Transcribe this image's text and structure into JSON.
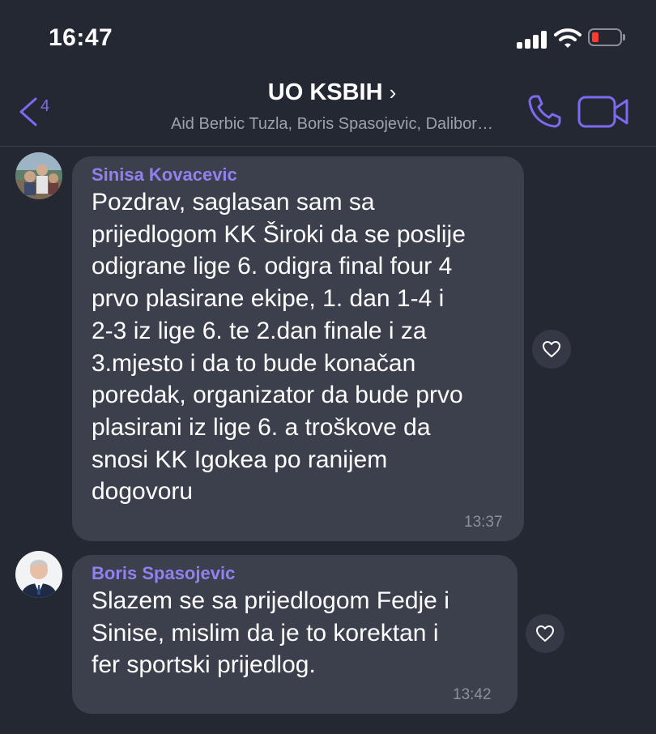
{
  "status_bar": {
    "time": "16:47",
    "signal_icon": "cellular-signal-icon",
    "wifi_icon": "wifi-icon",
    "battery_icon": "battery-low-icon",
    "battery_color": "#ff3b30"
  },
  "header": {
    "back_count": "4",
    "title": "UO KSBIH",
    "title_chevron": "›",
    "subtitle": "Aid Berbic Tuzla, Boris Spasojevic, Dalibor…",
    "accent_color": "#7c6bf0"
  },
  "messages": [
    {
      "sender": "Sinisa Kovacevic",
      "text": "Pozdrav, saglasan sam sa\nprijedlogom KK Široki da se poslije\nodigrane lige 6. odigra final four 4\nprvo plasirane ekipe, 1. dan 1-4 i\n2-3 iz lige 6. te 2.dan finale i za\n3.mjesto i da to bude konačan\nporedak, organizator da bude prvo\nplasirani iz lige 6. a troškove da\nsnosi KK Igokea po ranijem\ndogovoru",
      "time": "13:37"
    },
    {
      "sender": "Boris Spasojevic",
      "text": "Slazem se sa prijedlogom Fedje i\nSinise, mislim da je to korektan i\nfer sportski prijedlog.",
      "time": "13:42"
    }
  ]
}
